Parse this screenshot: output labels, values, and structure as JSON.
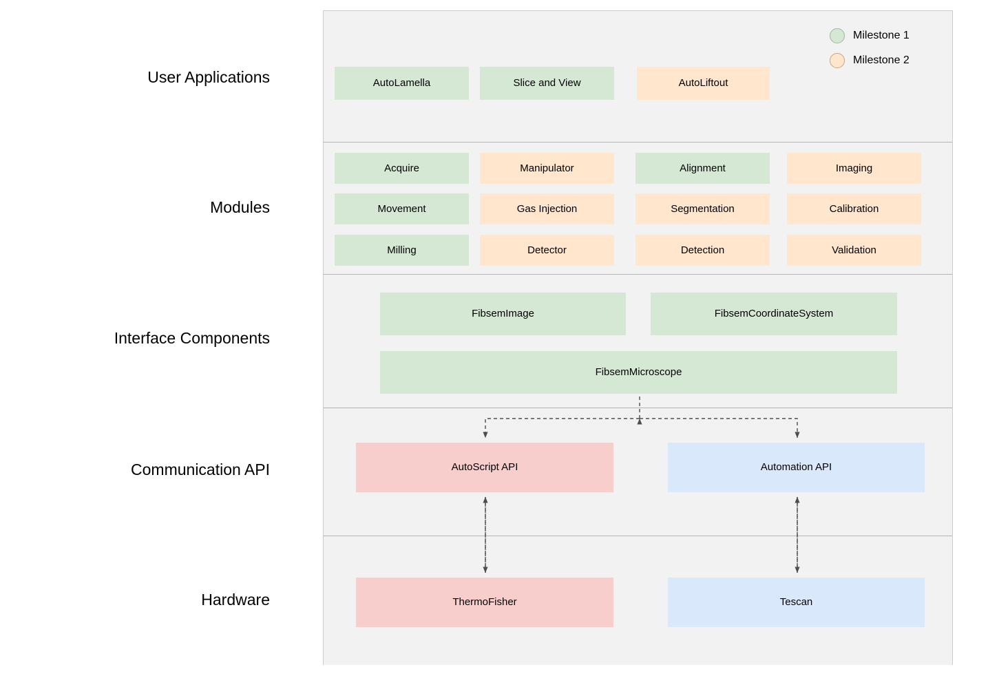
{
  "legend": {
    "items": [
      {
        "label": "Milestone 1",
        "color": "#d5e8d4",
        "icon": "circle-icon"
      },
      {
        "label": "Milestone 2",
        "color": "#ffe6cc",
        "icon": "circle-icon"
      }
    ]
  },
  "layers": [
    {
      "id": "user-applications",
      "label": "User Applications"
    },
    {
      "id": "modules",
      "label": "Modules"
    },
    {
      "id": "interface-components",
      "label": "Interface Components"
    },
    {
      "id": "communication-api",
      "label": "Communication API"
    },
    {
      "id": "hardware",
      "label": "Hardware"
    }
  ],
  "user_applications": {
    "nodes": [
      {
        "label": "AutoLamella",
        "color": "#d5e8d4",
        "milestone": "Milestone 1"
      },
      {
        "label": "Slice and View",
        "color": "#d5e8d4",
        "milestone": "Milestone 1"
      },
      {
        "label": "AutoLiftout",
        "color": "#ffe6cc",
        "milestone": "Milestone 2"
      }
    ]
  },
  "modules": {
    "nodes": [
      {
        "label": "Acquire",
        "color": "#d5e8d4",
        "milestone": "Milestone 1"
      },
      {
        "label": "Manipulator",
        "color": "#ffe6cc",
        "milestone": "Milestone 2"
      },
      {
        "label": "Alignment",
        "color": "#d5e8d4",
        "milestone": "Milestone 1"
      },
      {
        "label": "Imaging",
        "color": "#ffe6cc",
        "milestone": "Milestone 2"
      },
      {
        "label": "Movement",
        "color": "#d5e8d4",
        "milestone": "Milestone 1"
      },
      {
        "label": "Gas Injection",
        "color": "#ffe6cc",
        "milestone": "Milestone 2"
      },
      {
        "label": "Segmentation",
        "color": "#ffe6cc",
        "milestone": "Milestone 2"
      },
      {
        "label": "Calibration",
        "color": "#ffe6cc",
        "milestone": "Milestone 2"
      },
      {
        "label": "Milling",
        "color": "#d5e8d4",
        "milestone": "Milestone 1"
      },
      {
        "label": "Detector",
        "color": "#ffe6cc",
        "milestone": "Milestone 2"
      },
      {
        "label": "Detection",
        "color": "#ffe6cc",
        "milestone": "Milestone 2"
      },
      {
        "label": "Validation",
        "color": "#ffe6cc",
        "milestone": "Milestone 2"
      }
    ]
  },
  "interface_components": {
    "nodes": [
      {
        "label": "FibsemImage",
        "color": "#d5e8d4",
        "milestone": "Milestone 1"
      },
      {
        "label": "FibsemCoordinateSystem",
        "color": "#d5e8d4",
        "milestone": "Milestone 1"
      },
      {
        "label": "FibsemMicroscope",
        "color": "#d5e8d4",
        "milestone": "Milestone 1"
      }
    ]
  },
  "communication_api": {
    "nodes": [
      {
        "label": "AutoScript API",
        "color": "#f8cecc"
      },
      {
        "label": "Automation API",
        "color": "#dae8fc"
      }
    ]
  },
  "hardware": {
    "nodes": [
      {
        "label": "ThermoFisher",
        "color": "#f8cecc"
      },
      {
        "label": "Tescan",
        "color": "#dae8fc"
      }
    ]
  },
  "connections": [
    {
      "from": "FibsemMicroscope",
      "to": "AutoScript API",
      "style": "dashed",
      "direction": "one-way"
    },
    {
      "from": "FibsemMicroscope",
      "to": "Automation API",
      "style": "dashed",
      "direction": "one-way"
    },
    {
      "from": "AutoScript API",
      "to": "ThermoFisher",
      "style": "dashed",
      "direction": "bidirectional"
    },
    {
      "from": "Automation API",
      "to": "Tescan",
      "style": "dashed",
      "direction": "bidirectional"
    }
  ]
}
